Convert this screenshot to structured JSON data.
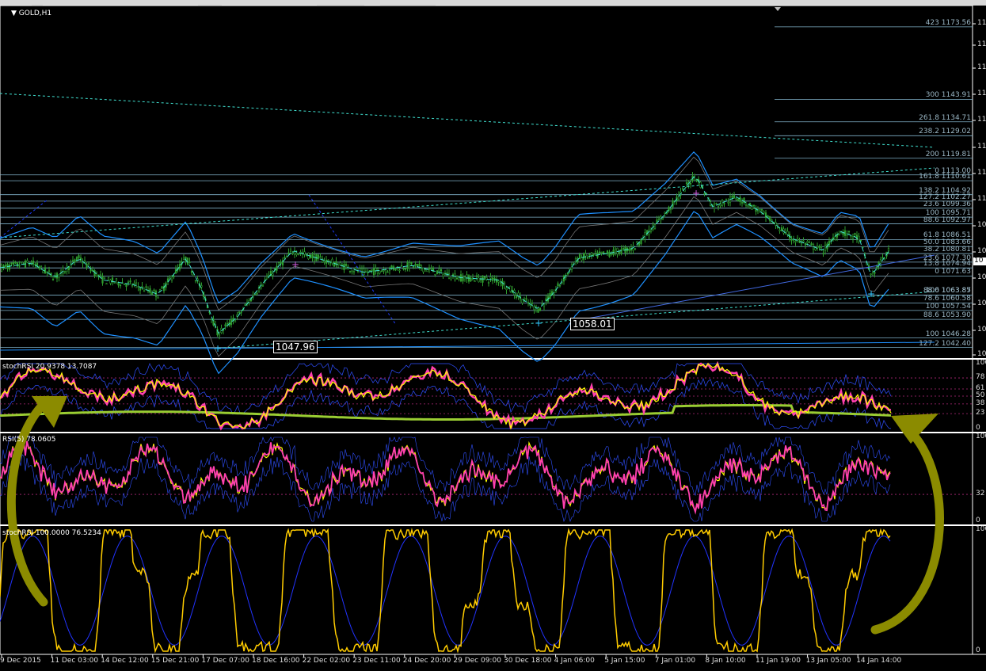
{
  "window": {
    "symbol_title": "GOLD,H1"
  },
  "panels": [
    {
      "id": "price",
      "title": "GOLD,H1"
    },
    {
      "id": "stochrsi1",
      "title": "stochRSI 20.9378 13.7087"
    },
    {
      "id": "rsi",
      "title": "RSI(5) 78.0605"
    },
    {
      "id": "stochrsi2",
      "title": "stochRSI 100.0000 76.5234"
    }
  ],
  "price_right_axis_labels": [
    "11",
    "11",
    "11",
    "11",
    "11",
    "11",
    "11",
    "11",
    "10",
    "10",
    "10",
    "10",
    "10",
    "10"
  ],
  "price_current_label": "10",
  "fib_levels": [
    {
      "ratio": "423",
      "price": "1173.56",
      "text": "423 1173.56"
    },
    {
      "ratio": "300",
      "price": "1143.91",
      "text": "300 1143.91"
    },
    {
      "ratio": "261.8",
      "price": "1134.71",
      "text": "261.8 1134.71"
    },
    {
      "ratio": "238.2",
      "price": "1129.02",
      "text": "238.2 1129.02"
    },
    {
      "ratio": "200",
      "price": "1119.81",
      "text": "200 1119.81"
    },
    {
      "ratio": "0",
      "price": "1113.00",
      "text": "0 1113.00"
    },
    {
      "ratio": "161.8",
      "price": "1110.61",
      "text": "161.8 1110.61"
    },
    {
      "ratio": "138.2",
      "price": "1104.92",
      "text": "138.2 1104.92"
    },
    {
      "ratio": "127.2",
      "price": "1102.27",
      "text": "127.2 1102.27"
    },
    {
      "ratio": "23.6",
      "price": "1099.36",
      "text": "23.6 1099.36"
    },
    {
      "ratio": "100",
      "price": "1095.71",
      "text": "100 1095.71"
    },
    {
      "ratio": "88.6",
      "price": "1092.97",
      "text": "88.6 1092.97"
    },
    {
      "ratio": "61.8",
      "price": "1086.51",
      "text": "61.8 1086.51"
    },
    {
      "ratio": "50.0",
      "price": "1083.66",
      "text": "50.0 1083.66"
    },
    {
      "ratio": "38.2",
      "price": "1080.81",
      "text": "38.2 1080.81"
    },
    {
      "ratio": "23.6",
      "price": "1077.30",
      "text": "23.6 1077.30"
    },
    {
      "ratio": "13.8",
      "price": "1074.94",
      "text": "13.8 1074.94"
    },
    {
      "ratio": "0",
      "price": "1071.63",
      "text": "0 1071.63"
    },
    {
      "ratio": "100",
      "price": "1063.85",
      "text": "100 1063.85"
    },
    {
      "ratio": "88.6",
      "price": "1063.87",
      "text": "88.6 1063.87"
    },
    {
      "ratio": "78.6",
      "price": "1060.58",
      "text": "78.6 1060.58"
    },
    {
      "ratio": "100",
      "price": "1057.54",
      "text": "100 1057.54"
    },
    {
      "ratio": "88.6",
      "price": "1053.90",
      "text": "88.6 1053.90"
    },
    {
      "ratio": "100",
      "price": "1046.28",
      "text": "100 1046.28"
    },
    {
      "ratio": "127.2",
      "price": "1042.40",
      "text": "127.2 1042.40"
    }
  ],
  "price_annotations": [
    {
      "text": "1047.96"
    },
    {
      "text": "1058.01"
    }
  ],
  "stoch1_axis": [
    "100",
    "78",
    "61",
    "50",
    "38",
    "23",
    "0"
  ],
  "rsi_axis": [
    "100",
    "32",
    "0"
  ],
  "stoch2_axis": [
    "100",
    "0"
  ],
  "time_axis": [
    "9 Dec 2015",
    "11 Dec 03:00",
    "14 Dec 12:00",
    "15 Dec 21:00",
    "17 Dec 07:00",
    "18 Dec 16:00",
    "22 Dec 02:00",
    "23 Dec 11:00",
    "24 Dec 20:00",
    "29 Dec 09:00",
    "30 Dec 18:00",
    "4 Jan 06:00",
    "5 Jan 15:00",
    "7 Jan 01:00",
    "8 Jan 10:00",
    "11 Jan 19:00",
    "13 Jan 05:00",
    "14 Jan 14:00"
  ],
  "chart_data": {
    "type": "line",
    "title": "GOLD,H1",
    "x": [
      "9 Dec 2015",
      "11 Dec 03:00",
      "14 Dec 12:00",
      "15 Dec 21:00",
      "17 Dec 07:00",
      "18 Dec 16:00",
      "22 Dec 02:00",
      "23 Dec 11:00",
      "24 Dec 20:00",
      "29 Dec 09:00",
      "30 Dec 18:00",
      "4 Jan 06:00",
      "5 Jan 15:00",
      "7 Jan 01:00",
      "8 Jan 10:00",
      "11 Jan 19:00",
      "13 Jan 05:00",
      "14 Jan 14:00"
    ],
    "series": [
      {
        "values": [
          1075,
          1080,
          1068,
          1078,
          1047.96,
          1085,
          1080,
          1074,
          1077,
          1070,
          1058.01,
          1080,
          1085,
          1113,
          1102,
          1090,
          1092,
          1085
        ]
      }
    ],
    "ylim": [
      1040,
      1180
    ],
    "grid": false,
    "colors": {
      "candles": "#2e9b2e",
      "bands": "#1e90ff",
      "fib": "#7fb0c8",
      "trend": "#40e0d0",
      "stoch": "#ffff00",
      "stoch_signal": "#ff3fb0",
      "rsi": "#ffff00",
      "rsi_signal": "#ff3fb0",
      "stoch2": "#ffcc00",
      "arrow": "#8b8b00"
    }
  },
  "indicator_values": {
    "stochrsi1_k": 20.9378,
    "stochrsi1_d": 13.7087,
    "rsi5": 78.0605,
    "stochrsi2_k": 100.0,
    "stochrsi2_d": 76.5234
  }
}
